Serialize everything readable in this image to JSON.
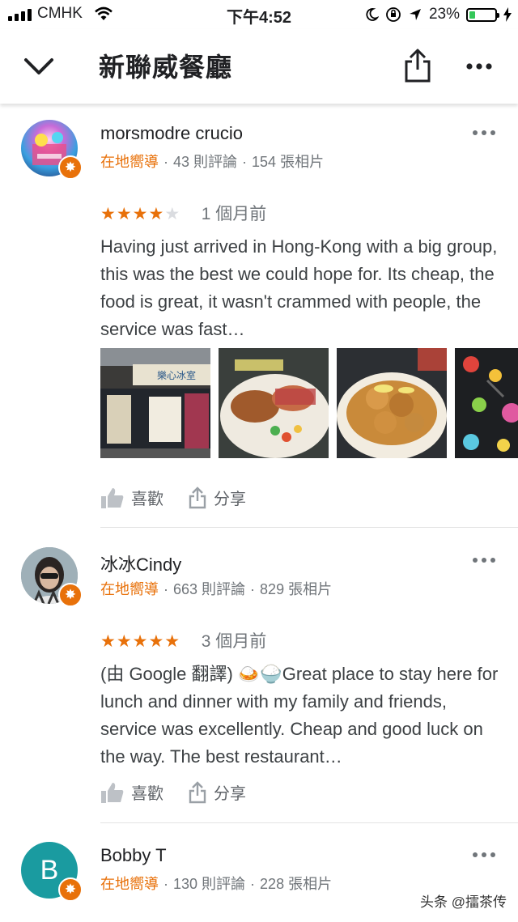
{
  "status_bar": {
    "carrier": "CMHK",
    "time": "下午4:52",
    "battery": "23%",
    "battery_level": 0.23
  },
  "header": {
    "title": "新聯威餐廳"
  },
  "reviews": [
    {
      "author": "morsmodre crucio",
      "guide": "在地嚮導",
      "reviews_count": "43 則評論",
      "photos_count": "154 張相片",
      "rating": 4,
      "stars_on": "★★★★",
      "stars_off": "★",
      "age": "1 個月前",
      "text": "Having just arrived in Hong-Kong with a big group, this was the best we could hope for. Its cheap, the food is great, it wasn't crammed with people, the service was fast…",
      "photos": [
        "storefront-photo",
        "fried-chicken-wings-photo",
        "lemon-chicken-photo",
        "colorful-interior-photo"
      ],
      "like_label": "喜歡",
      "share_label": "分享"
    },
    {
      "author": "冰冰Cindy",
      "guide": "在地嚮導",
      "reviews_count": "663 則評論",
      "photos_count": "829 張相片",
      "rating": 5,
      "stars_on": "★★★★★",
      "stars_off": "",
      "age": "3 個月前",
      "text": "(由 Google 翻譯) 🍛🍚Great place to stay here for lunch and dinner with my family and friends, service was excellently. Cheap and good luck on the way. The best restaurant…",
      "like_label": "喜歡",
      "share_label": "分享"
    },
    {
      "author": "Bobby T",
      "avatar_initial": "B",
      "guide": "在地嚮導",
      "reviews_count": "130 則評論",
      "photos_count": "228 張相片"
    }
  ],
  "watermark": "头条 @擂茶传",
  "colors": {
    "guide_orange": "#e8710a",
    "star_orange": "#e8710a",
    "meta_gray": "#70757a",
    "avatar_teal": "#1a9ba0"
  }
}
